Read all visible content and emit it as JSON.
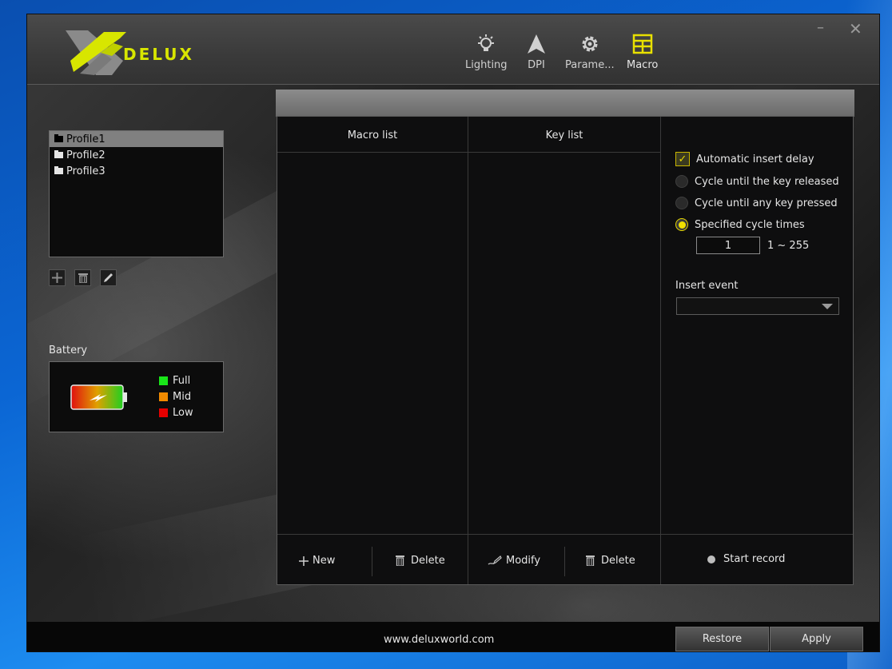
{
  "window": {
    "brand": "DELUX",
    "minimize": "–",
    "close": "✕"
  },
  "nav": [
    {
      "label": "Lighting",
      "icon": "bulb-icon",
      "active": false
    },
    {
      "label": "DPI",
      "icon": "arrow-up-icon",
      "active": false
    },
    {
      "label": "Parame...",
      "icon": "gear-icon",
      "active": false
    },
    {
      "label": "Macro",
      "icon": "macro-grid-icon",
      "active": true
    }
  ],
  "profiles": {
    "items": [
      "Profile1",
      "Profile2",
      "Profile3"
    ],
    "selected": "Profile1",
    "tools": [
      "add-icon",
      "trash-icon",
      "pencil-icon"
    ]
  },
  "battery": {
    "label": "Battery",
    "legend": [
      {
        "label": "Full",
        "color": "#19e619"
      },
      {
        "label": "Mid",
        "color": "#f08a00"
      },
      {
        "label": "Low",
        "color": "#e60000"
      }
    ]
  },
  "macro": {
    "macro_list_title": "Macro list",
    "key_list_title": "Key list",
    "buttons": {
      "new": "New",
      "delete_macro": "Delete",
      "modify": "Modify",
      "delete_key": "Delete"
    }
  },
  "options": {
    "auto_delay": {
      "label": "Automatic insert delay",
      "checked": true
    },
    "cycle_release": {
      "label": "Cycle until the key released",
      "selected": false
    },
    "cycle_any": {
      "label": "Cycle until any key pressed",
      "selected": false
    },
    "cycle_times": {
      "label": "Specified cycle times",
      "selected": true
    },
    "cycle_count": "1",
    "cycle_range": "1 ~ 255",
    "insert_event_label": "Insert event",
    "insert_event_value": "",
    "start_record": "Start record"
  },
  "footer": {
    "url": "www.deluxworld.com",
    "restore": "Restore",
    "apply": "Apply"
  },
  "colors": {
    "accent": "#d8e600",
    "radio_on": "#f0e000"
  }
}
